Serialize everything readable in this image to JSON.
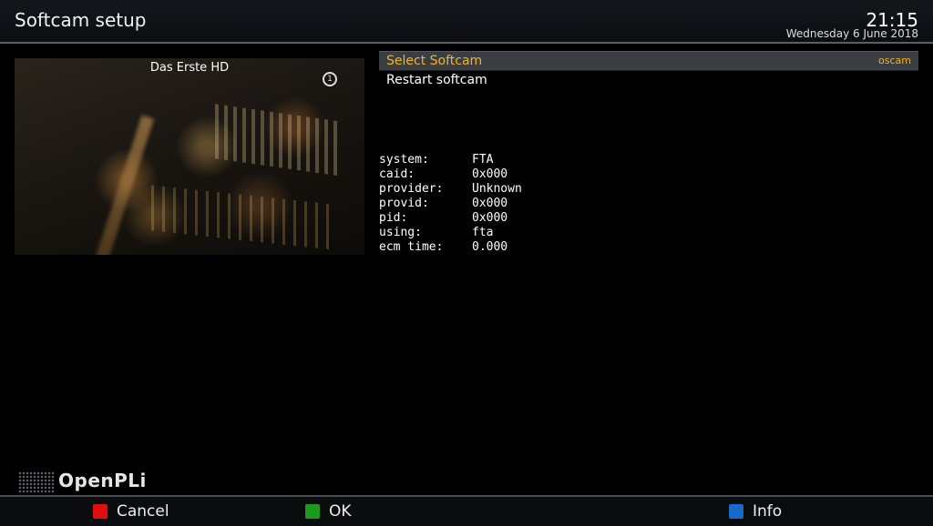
{
  "header": {
    "title": "Softcam setup",
    "time": "21:15",
    "date": "Wednesday  6 June 2018"
  },
  "preview": {
    "channel": "Das Erste HD",
    "logo_icon": "das-erste-logo-icon"
  },
  "menu": {
    "items": [
      {
        "label": "Select Softcam",
        "value": "oscam",
        "selected": true
      },
      {
        "label": "Restart softcam",
        "value": "",
        "selected": false
      }
    ]
  },
  "ecm_info": {
    "rows": [
      {
        "label": "system:",
        "value": "FTA"
      },
      {
        "label": "caid:",
        "value": "0x000"
      },
      {
        "label": "provider:",
        "value": "Unknown"
      },
      {
        "label": "provid:",
        "value": "0x000"
      },
      {
        "label": "pid:",
        "value": "0x000"
      },
      {
        "label": "using:",
        "value": "fta"
      },
      {
        "label": "ecm time:",
        "value": "0.000"
      }
    ]
  },
  "branding": {
    "logo_text": "OpenPLi"
  },
  "footer": {
    "buttons": [
      {
        "label": "Cancel",
        "color": "#e10e0e"
      },
      {
        "label": "OK",
        "color": "#1d9a1d"
      },
      {
        "label": "Info",
        "color": "#1869c9"
      }
    ]
  },
  "colors": {
    "accent": "#f0b51e",
    "selection_bg": "#3a3d42"
  }
}
